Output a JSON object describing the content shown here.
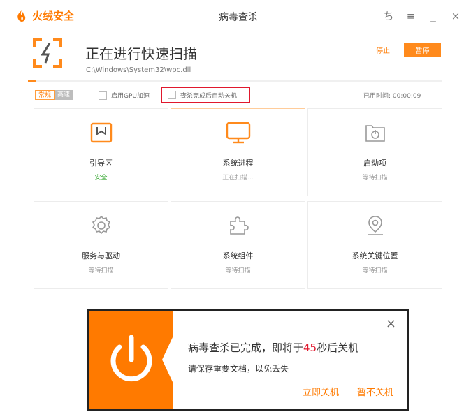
{
  "app": {
    "brand": "火绒安全",
    "window_title": "病毒查杀"
  },
  "window_controls": {
    "skin": "ち",
    "menu": "≡",
    "minimize": "_",
    "close": "×"
  },
  "scan": {
    "title": "正在进行快速扫描",
    "path": "C:\\Windows\\System32\\wpc.dll",
    "stop_label": "停止",
    "pause_label": "暂停",
    "progress_fraction": 0.02
  },
  "options": {
    "mode_normal": "常规",
    "mode_fast": "高速",
    "gpu_label": "启用GPU加速",
    "shutdown_label": "查杀完成后自动关机",
    "elapsed_label": "已用时间: 00:00:09"
  },
  "tiles": [
    {
      "name": "引导区",
      "status": "安全",
      "icon": "boot-icon",
      "state": "safe"
    },
    {
      "name": "系统进程",
      "status": "正在扫描...",
      "icon": "monitor-icon",
      "state": "active"
    },
    {
      "name": "启动项",
      "status": "等待扫描",
      "icon": "power-folder-icon",
      "state": "wait"
    },
    {
      "name": "服务与驱动",
      "status": "等待扫描",
      "icon": "gear-icon",
      "state": "wait"
    },
    {
      "name": "系统组件",
      "status": "等待扫描",
      "icon": "puzzle-icon",
      "state": "wait"
    },
    {
      "name": "系统关键位置",
      "status": "等待扫描",
      "icon": "location-icon",
      "state": "wait"
    }
  ],
  "popup": {
    "msg_prefix": "病毒查杀已完成，即将于",
    "seconds": "45",
    "msg_suffix": "秒后关机",
    "hint": "请保存重要文档，以免丢失",
    "shutdown_now": "立即关机",
    "cancel_shutdown": "暂不关机",
    "close": "×"
  },
  "colors": {
    "accent": "#ff7a00",
    "safe": "#3aa935",
    "danger": "#e0182d"
  }
}
